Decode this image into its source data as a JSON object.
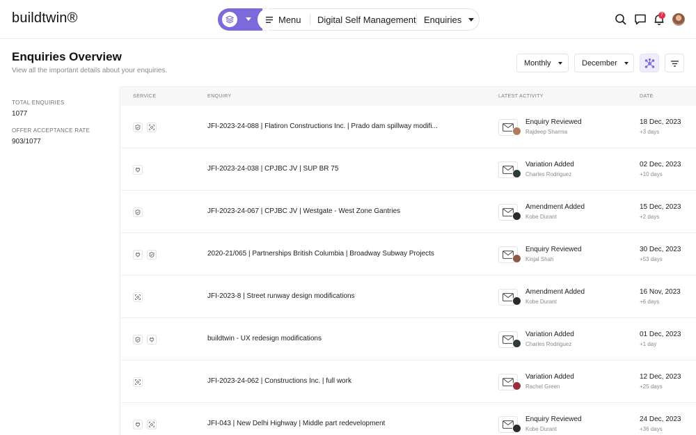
{
  "app": {
    "logo": "buildtwin®"
  },
  "nav": {
    "menu_label": "Menu",
    "items": [
      "Digital Self Management",
      "Enquiries"
    ],
    "notification_count": "7"
  },
  "header": {
    "title": "Enquiries Overview",
    "subtitle": "View all the important details about your enquiries.",
    "period_select": "Monthly",
    "month_select": "December"
  },
  "stats": [
    {
      "label": "TOTAL ENQUIRIES",
      "value": "1077"
    },
    {
      "label": "OFFER ACCEPTANCE RATE",
      "value": "903/1077"
    }
  ],
  "table": {
    "columns": [
      "SERVICE",
      "ENQUIRY",
      "LATEST ACTIVITY",
      "DATE"
    ],
    "rows": [
      {
        "services": [
          "shield-icon",
          "scan-icon"
        ],
        "enquiry": "JFI-2023-24-088 | Flatiron Constructions Inc. | Prado dam spillway modifi...",
        "activity": "Enquiry Reviewed",
        "person": "Rajdeep Sharma",
        "avatar_color": "#b07a5c",
        "date": "18 Dec, 2023",
        "ago": "+3 days"
      },
      {
        "services": [
          "plug-icon"
        ],
        "enquiry": "JFI-2023-24-038 | CPJBC JV | SUP BR 75",
        "activity": "Variation Added",
        "person": "Charles Rodriguez",
        "avatar_color": "#2f3b3a",
        "date": "02 Dec, 2023",
        "ago": "+10 days"
      },
      {
        "services": [
          "shield-icon"
        ],
        "enquiry": "JFI-2023-24-067 | CPJBC JV | Westgate - West Zone Gantries",
        "activity": "Amendment Added",
        "person": "Kobe Durant",
        "avatar_color": "#2b2b2b",
        "date": "15 Dec, 2023",
        "ago": "+2 days"
      },
      {
        "services": [
          "plug-icon",
          "shield-icon"
        ],
        "enquiry": "2020-21/065 | Partnerships British Columbia | Broadway Subway Projects",
        "activity": "Enquiry Reviewed",
        "person": "Kinjal Shah",
        "avatar_color": "#8a5a44",
        "date": "30 Dec, 2023",
        "ago": "+53 days"
      },
      {
        "services": [
          "scan-icon"
        ],
        "enquiry": "JFI-2023-8 | Street runway design modifications",
        "activity": "Amendment Added",
        "person": "Kobe Durant",
        "avatar_color": "#2b2b2b",
        "date": "16 Nov, 2023",
        "ago": "+6 days"
      },
      {
        "services": [
          "shield-icon",
          "plug-icon"
        ],
        "enquiry": "buildtwin - UX redesign modifications",
        "activity": "Variation Added",
        "person": "Charles Rodriguez",
        "avatar_color": "#2f3b3a",
        "date": "01 Dec, 2023",
        "ago": "+1 day"
      },
      {
        "services": [
          "scan-icon"
        ],
        "enquiry": "JFI-2023-24-062 | Constructions Inc. | full work",
        "activity": "Variation Added",
        "person": "Rachel Green",
        "avatar_color": "#9a2f3c",
        "date": "12 Dec, 2023",
        "ago": "+25 days"
      },
      {
        "services": [
          "plug-icon",
          "scan-icon"
        ],
        "enquiry": "JFI-043 | New Delhi Highway | Middle part redevelopment",
        "activity": "Enquiry Reviewed",
        "person": "Kobe Durant",
        "avatar_color": "#2b2b2b",
        "date": "24 Dec, 2023",
        "ago": "+36 days"
      }
    ]
  }
}
